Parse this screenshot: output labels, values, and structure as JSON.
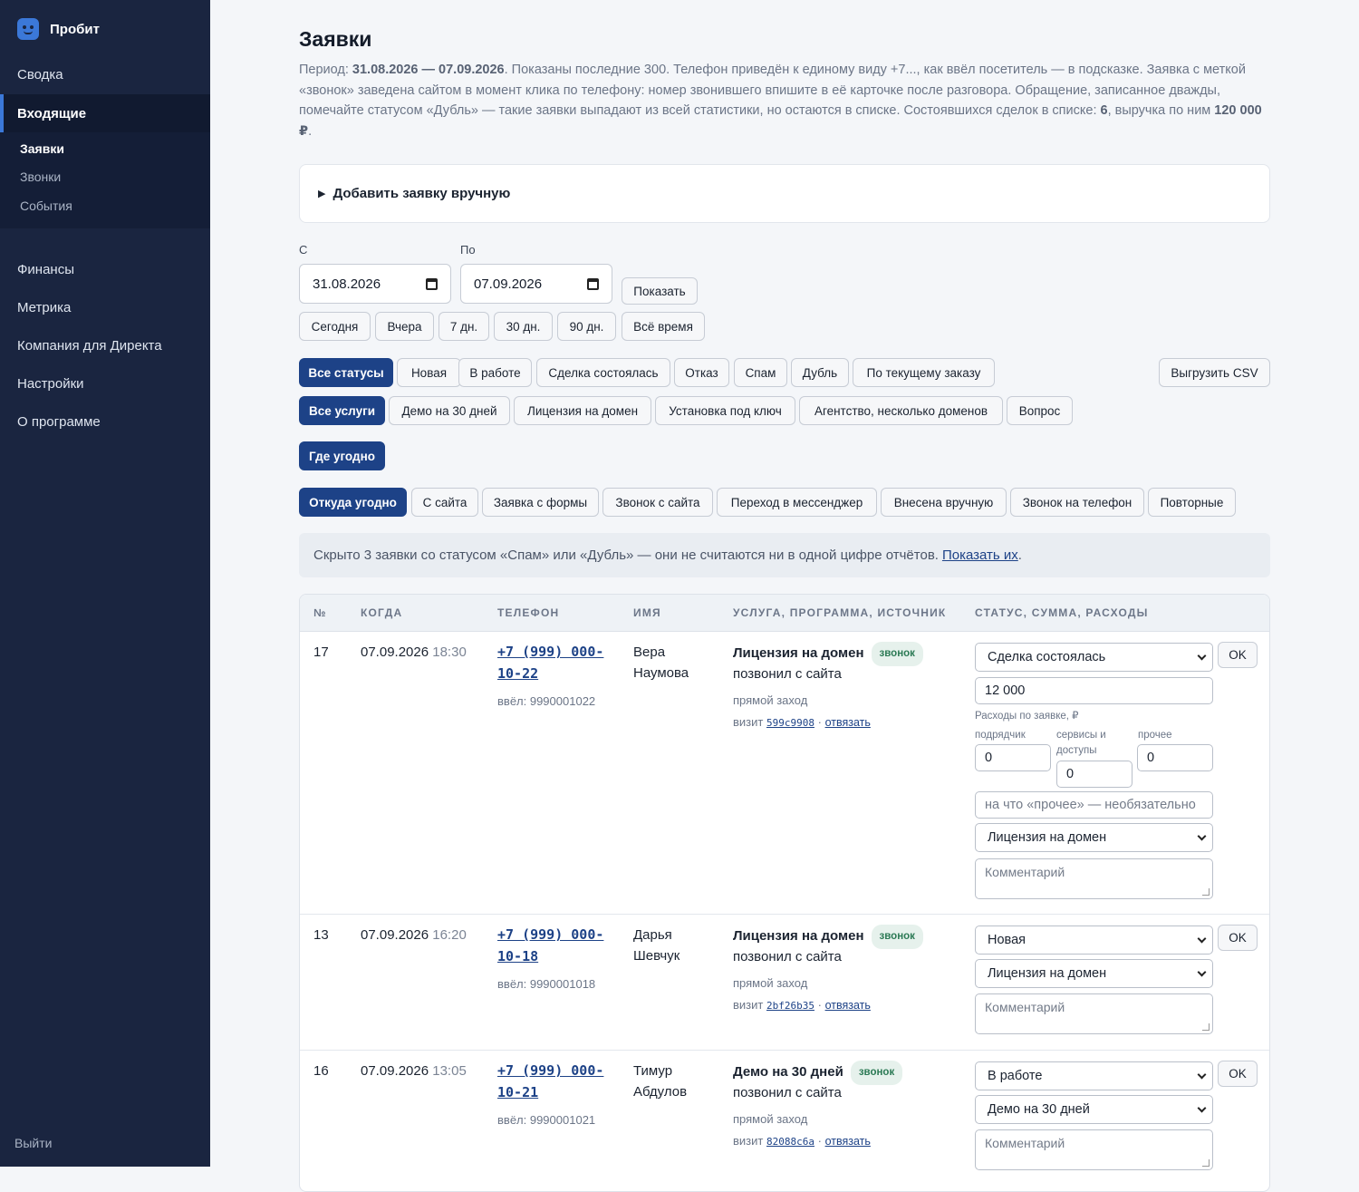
{
  "app": {
    "name": "Пробит"
  },
  "nav": {
    "summary": "Сводка",
    "incoming": "Входящие",
    "sub": {
      "requests": "Заявки",
      "calls": "Звонки",
      "events": "События"
    },
    "finance": "Финансы",
    "metrics": "Метрика",
    "campaign": "Компания для Директа",
    "settings": "Настройки",
    "about": "О программе",
    "logout": "Выйти"
  },
  "page": {
    "title": "Заявки",
    "intro": {
      "p1": "Период: ",
      "period": "31.08.2026 — 07.09.2026",
      "p2": ". Показаны последние 300. Телефон приведён к единому виду +7..., как ввёл посетитель — в подсказке. Заявка с меткой «звонок» заведена сайтом в момент клика по телефону: номер звонившего впишите в её карточке после разговора. Обращение, записанное дважды, помечайте статусом «Дубль» — такие заявки выпадают из всей статистики, но остаются в списке. Состоявшихся сделок в списке: ",
      "deals": "6",
      "p3": ", выручка по ним ",
      "revenue": "120 000 ₽",
      "p4": "."
    },
    "add_manual": "Добавить заявку вручную"
  },
  "filters": {
    "from_label": "С",
    "to_label": "По",
    "from_value": "31.08.2026",
    "to_value": "07.09.2026",
    "show": "Показать",
    "quick": [
      "Сегодня",
      "Вчера",
      "7 дн.",
      "30 дн.",
      "90 дн.",
      "Всё время"
    ],
    "statuses": [
      "Все статусы",
      "Новая",
      "В работе",
      "Сделка состоялась",
      "Отказ",
      "Спам",
      "Дубль",
      "По текущему заказу"
    ],
    "export": "Выгрузить CSV",
    "services": [
      "Все услуги",
      "Демо на 30 дней",
      "Лицензия на домен",
      "Установка под ключ",
      "Агентство, несколько доменов",
      "Вопрос"
    ],
    "where": [
      "Где угодно"
    ],
    "sources": [
      "Откуда угодно",
      "С сайта",
      "Заявка с формы",
      "Звонок с сайта",
      "Переход в мессенджер",
      "Внесена вручную",
      "Звонок на телефон",
      "Повторные"
    ]
  },
  "notice": {
    "text": "Скрыто 3 заявки со статусом «Спам» или «Дубль» — они не считаются ни в одной цифре отчётов.",
    "link": "Показать их",
    "end": "."
  },
  "table": {
    "headers": [
      "№",
      "КОГДА",
      "ТЕЛЕФОН",
      "ИМЯ",
      "УСЛУГА, ПРОГРАММА, ИСТОЧНИК",
      "СТАТУС, СУММА, РАСХОДЫ"
    ],
    "rows": [
      {
        "num": "17",
        "date": "07.09.2026",
        "time": "18:30",
        "phone1": "+7 (999) 000-",
        "phone2": "10-22",
        "entered": "ввёл: 9990001022",
        "name1": "Вера",
        "name2": "Наумова",
        "service": "Лицензия на домен",
        "tag": "звонок",
        "source": "позвонил с сайта",
        "channel": "прямой заход",
        "visit_label": "визит",
        "visit_id": "599c9908",
        "sep": "·",
        "unlink": "отвязать",
        "status": "Сделка состоялась",
        "ok": "OK",
        "amount": "12 000",
        "expenses_label": "Расходы по заявке, ₽",
        "contractor_label": "подрядчик",
        "services_label1": "сервисы и",
        "services_label2": "доступы",
        "other_label": "прочее",
        "contractor": "0",
        "services_cost": "0",
        "other": "0",
        "other_placeholder": "на что «прочее» — необязательно",
        "service_select": "Лицензия на домен",
        "comment_placeholder": "Комментарий"
      },
      {
        "num": "13",
        "date": "07.09.2026",
        "time": "16:20",
        "phone1": "+7 (999) 000-",
        "phone2": "10-18",
        "entered": "ввёл: 9990001018",
        "name1": "Дарья",
        "name2": "Шевчук",
        "service": "Лицензия на домен",
        "tag": "звонок",
        "source": "позвонил с сайта",
        "channel": "прямой заход",
        "visit_label": "визит",
        "visit_id": "2bf26b35",
        "sep": "·",
        "unlink": "отвязать",
        "status": "Новая",
        "ok": "OK",
        "service_select": "Лицензия на домен",
        "comment_placeholder": "Комментарий"
      },
      {
        "num": "16",
        "date": "07.09.2026",
        "time": "13:05",
        "phone1": "+7 (999) 000-",
        "phone2": "10-21",
        "entered": "ввёл: 9990001021",
        "name1": "Тимур",
        "name2": "Абдулов",
        "service": "Демо на 30 дней",
        "tag": "звонок",
        "source": "позвонил с сайта",
        "channel": "прямой заход",
        "visit_label": "визит",
        "visit_id": "82088c6a",
        "sep": "·",
        "unlink": "отвязать",
        "status": "В работе",
        "ok": "OK",
        "service_select": "Демо на 30 дней",
        "comment_placeholder": "Комментарий"
      }
    ]
  }
}
